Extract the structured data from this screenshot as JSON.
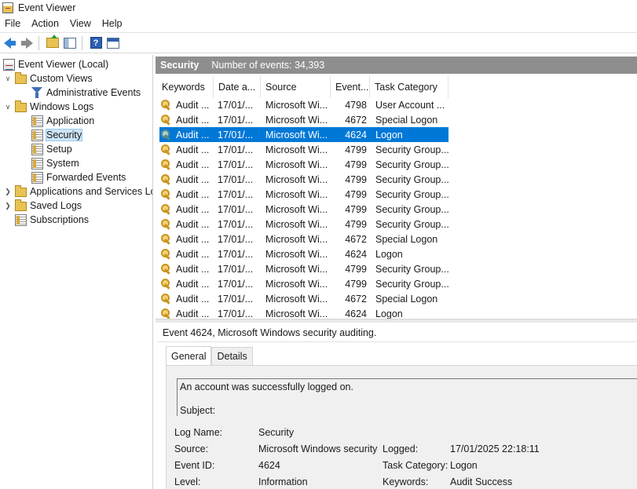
{
  "window": {
    "title": "Event Viewer"
  },
  "menu": [
    "File",
    "Action",
    "View",
    "Help"
  ],
  "tree": {
    "root": "Event Viewer (Local)",
    "custom_views": "Custom Views",
    "admin_events": "Administrative Events",
    "windows_logs": "Windows Logs",
    "application": "Application",
    "security": "Security",
    "setup": "Setup",
    "system": "System",
    "forwarded": "Forwarded Events",
    "apps_services": "Applications and Services Lo",
    "saved_logs": "Saved Logs",
    "subscriptions": "Subscriptions"
  },
  "log_header": {
    "title": "Security",
    "count": "Number of events: 34,393"
  },
  "columns": {
    "keywords": "Keywords",
    "date": "Date a...",
    "source": "Source",
    "event_id": "Event...",
    "category": "Task Category"
  },
  "events": [
    {
      "keywords": "Audit ...",
      "date": "17/01/...",
      "source": "Microsoft Wi...",
      "id": "4798",
      "category": "User Account ..."
    },
    {
      "keywords": "Audit ...",
      "date": "17/01/...",
      "source": "Microsoft Wi...",
      "id": "4672",
      "category": "Special Logon"
    },
    {
      "keywords": "Audit ...",
      "date": "17/01/...",
      "source": "Microsoft Wi...",
      "id": "4624",
      "category": "Logon"
    },
    {
      "keywords": "Audit ...",
      "date": "17/01/...",
      "source": "Microsoft Wi...",
      "id": "4799",
      "category": "Security Group..."
    },
    {
      "keywords": "Audit ...",
      "date": "17/01/...",
      "source": "Microsoft Wi...",
      "id": "4799",
      "category": "Security Group..."
    },
    {
      "keywords": "Audit ...",
      "date": "17/01/...",
      "source": "Microsoft Wi...",
      "id": "4799",
      "category": "Security Group..."
    },
    {
      "keywords": "Audit ...",
      "date": "17/01/...",
      "source": "Microsoft Wi...",
      "id": "4799",
      "category": "Security Group..."
    },
    {
      "keywords": "Audit ...",
      "date": "17/01/...",
      "source": "Microsoft Wi...",
      "id": "4799",
      "category": "Security Group..."
    },
    {
      "keywords": "Audit ...",
      "date": "17/01/...",
      "source": "Microsoft Wi...",
      "id": "4799",
      "category": "Security Group..."
    },
    {
      "keywords": "Audit ...",
      "date": "17/01/...",
      "source": "Microsoft Wi...",
      "id": "4672",
      "category": "Special Logon"
    },
    {
      "keywords": "Audit ...",
      "date": "17/01/...",
      "source": "Microsoft Wi...",
      "id": "4624",
      "category": "Logon"
    },
    {
      "keywords": "Audit ...",
      "date": "17/01/...",
      "source": "Microsoft Wi...",
      "id": "4799",
      "category": "Security Group..."
    },
    {
      "keywords": "Audit ...",
      "date": "17/01/...",
      "source": "Microsoft Wi...",
      "id": "4799",
      "category": "Security Group..."
    },
    {
      "keywords": "Audit ...",
      "date": "17/01/...",
      "source": "Microsoft Wi...",
      "id": "4672",
      "category": "Special Logon"
    },
    {
      "keywords": "Audit ...",
      "date": "17/01/...",
      "source": "Microsoft Wi...",
      "id": "4624",
      "category": "Logon"
    }
  ],
  "selected_index": 2,
  "details": {
    "title": "Event 4624, Microsoft Windows security auditing.",
    "tab_general": "General",
    "tab_details": "Details",
    "message_line1": "An account was successfully logged on.",
    "message_line2": "Subject:",
    "log_name_label": "Log Name:",
    "log_name_value": "Security",
    "source_label": "Source:",
    "source_value": "Microsoft Windows security",
    "logged_label": "Logged:",
    "logged_value": "17/01/2025 22:18:11",
    "event_id_label": "Event ID:",
    "event_id_value": "4624",
    "task_label": "Task Category:",
    "task_value": "Logon",
    "level_label": "Level:",
    "level_value": "Information",
    "keywords_label": "Keywords:",
    "keywords_value": "Audit Success"
  },
  "colors": {
    "selection": "#0078d7",
    "header_bar": "#8e8e8e",
    "tree_selection": "#cce4f7"
  }
}
